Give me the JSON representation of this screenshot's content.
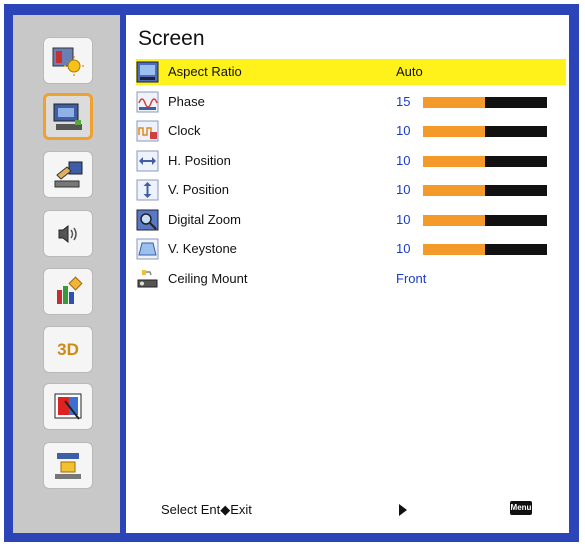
{
  "title": "Screen",
  "sidebar": {
    "items": [
      {
        "icon": "image-settings-icon",
        "selected": false
      },
      {
        "icon": "screen-settings-icon",
        "selected": true
      },
      {
        "icon": "setup-icon",
        "selected": false
      },
      {
        "icon": "volume-icon",
        "selected": false
      },
      {
        "icon": "options-icon",
        "selected": false
      },
      {
        "icon": "3d-icon",
        "label": "3D",
        "selected": false
      },
      {
        "icon": "presentation-icon",
        "selected": false
      },
      {
        "icon": "network-icon",
        "selected": false
      }
    ]
  },
  "rows": [
    {
      "label": "Aspect Ratio",
      "value": "Auto",
      "icon": "aspect-ratio-icon",
      "highlighted": true
    },
    {
      "label": "Phase",
      "value": "15",
      "icon": "phase-icon",
      "level": 0.5
    },
    {
      "label": "Clock",
      "value": "10",
      "icon": "clock-icon",
      "level": 0.5
    },
    {
      "label": "H. Position",
      "value": "10",
      "icon": "h-position-icon",
      "level": 0.5
    },
    {
      "label": "V. Position",
      "value": "10",
      "icon": "v-position-icon",
      "level": 0.5
    },
    {
      "label": "Digital Zoom",
      "value": "10",
      "icon": "digital-zoom-icon",
      "level": 0.5
    },
    {
      "label": "V. Keystone",
      "value": "10",
      "icon": "v-keystone-icon",
      "level": 0.5
    },
    {
      "label": "Ceiling Mount",
      "value": "Front",
      "icon": "ceiling-mount-icon"
    }
  ],
  "footer": {
    "hint": "Select Ent◆Exit",
    "menu_key": "Menu"
  },
  "colors": {
    "frame": "#2b44b8",
    "highlight": "#fff21a",
    "bar_fill": "#f39a2a",
    "value_text": "#1a3cc8"
  }
}
